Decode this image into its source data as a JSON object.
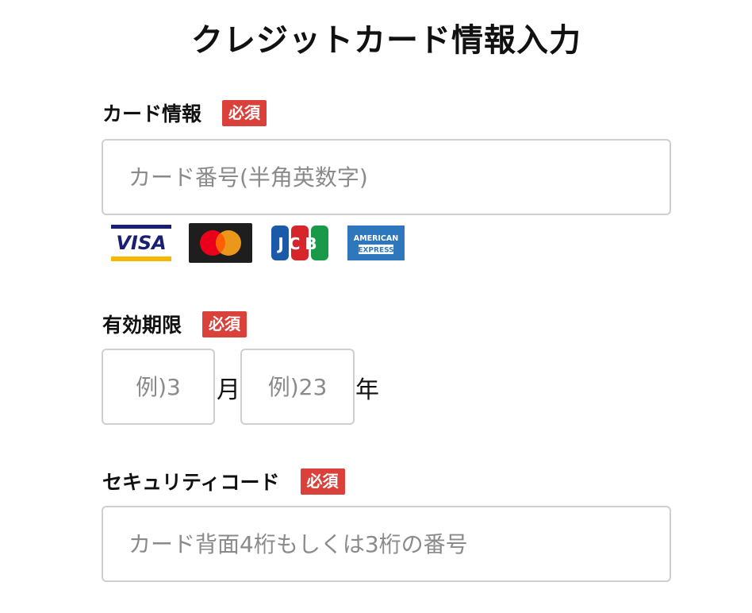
{
  "page": {
    "title": "クレジットカード情報入力"
  },
  "card_info": {
    "label": "カード情報",
    "required_badge": "必須",
    "card_number_placeholder": "カード番号(半角英数字)",
    "brands": [
      "VISA",
      "mastercard",
      "JCB",
      "AMERICAN EXPRESS"
    ],
    "brand_texts": {
      "visa": "VISA",
      "jcb": "JCB",
      "amex_line1": "AMERICAN",
      "amex_line2": "EXPRESS"
    }
  },
  "expiry": {
    "label": "有効期限",
    "required_badge": "必須",
    "month_placeholder": "例)3",
    "month_unit": "月",
    "year_placeholder": "例)23",
    "year_unit": "年"
  },
  "security_code": {
    "label": "セキュリティコード",
    "required_badge": "必須",
    "placeholder": "カード背面4桁もしくは3桁の番号"
  },
  "colors": {
    "badge": "#d9413a",
    "input_border": "#cfcfcf",
    "placeholder": "#8a8a8a",
    "visa_blue": "#1a1f71",
    "visa_gold": "#f7b600",
    "mc_red": "#eb001b",
    "mc_orange": "#f79e1b",
    "amex_blue": "#2e77bc"
  }
}
